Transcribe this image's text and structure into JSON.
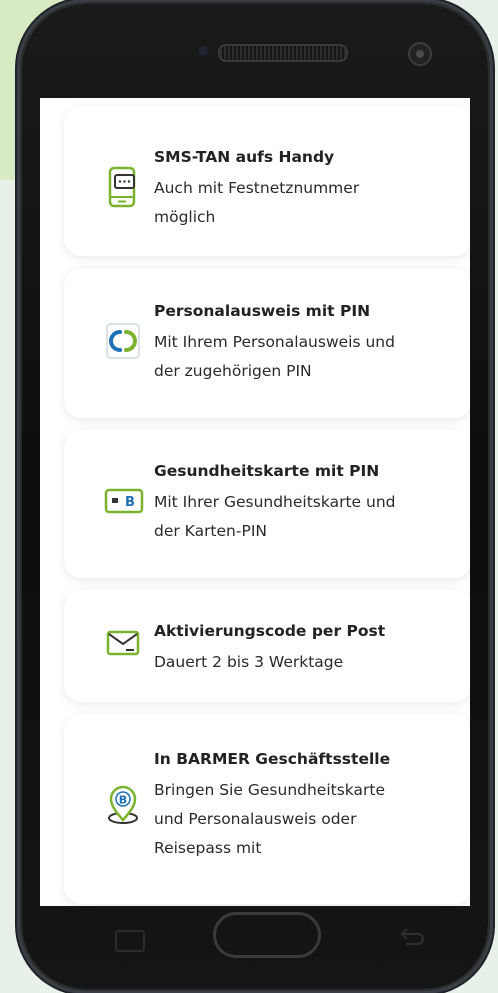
{
  "colors": {
    "accent_green": "#7bb32e",
    "blue": "#1f6fb4",
    "background": "#e7f1ea",
    "card_text": "#222222"
  },
  "options": [
    {
      "title": "SMS-TAN aufs Handy",
      "lines": [
        "Auch mit Festnetznummer",
        "möglich"
      ],
      "icon": "mobile-phone-sms-icon"
    },
    {
      "title": "Personalausweis mit PIN",
      "lines": [
        "Mit Ihrem Personalausweis und",
        "der zugehörigen PIN"
      ],
      "icon": "id-card-logo-icon"
    },
    {
      "title": "Gesundheitskarte mit PIN",
      "lines": [
        "Mit Ihrer Gesundheitskarte und",
        "der Karten-PIN"
      ],
      "icon": "health-card-icon"
    },
    {
      "title": "Aktivierungscode per Post",
      "lines": [
        "Dauert 2 bis 3 Werktage"
      ],
      "icon": "envelope-icon"
    },
    {
      "title": "In BARMER Geschäftsstelle",
      "lines": [
        "Bringen Sie Gesundheitskarte",
        "und Personalausweis oder",
        "Reisepass mit"
      ],
      "icon": "location-pin-icon"
    }
  ],
  "health_card_letter": "B",
  "location_pin_letter": "B",
  "navbar": {
    "recent_icon": "recent-apps-icon",
    "home_icon": "home-button",
    "back_icon": "back-arrow-icon"
  }
}
